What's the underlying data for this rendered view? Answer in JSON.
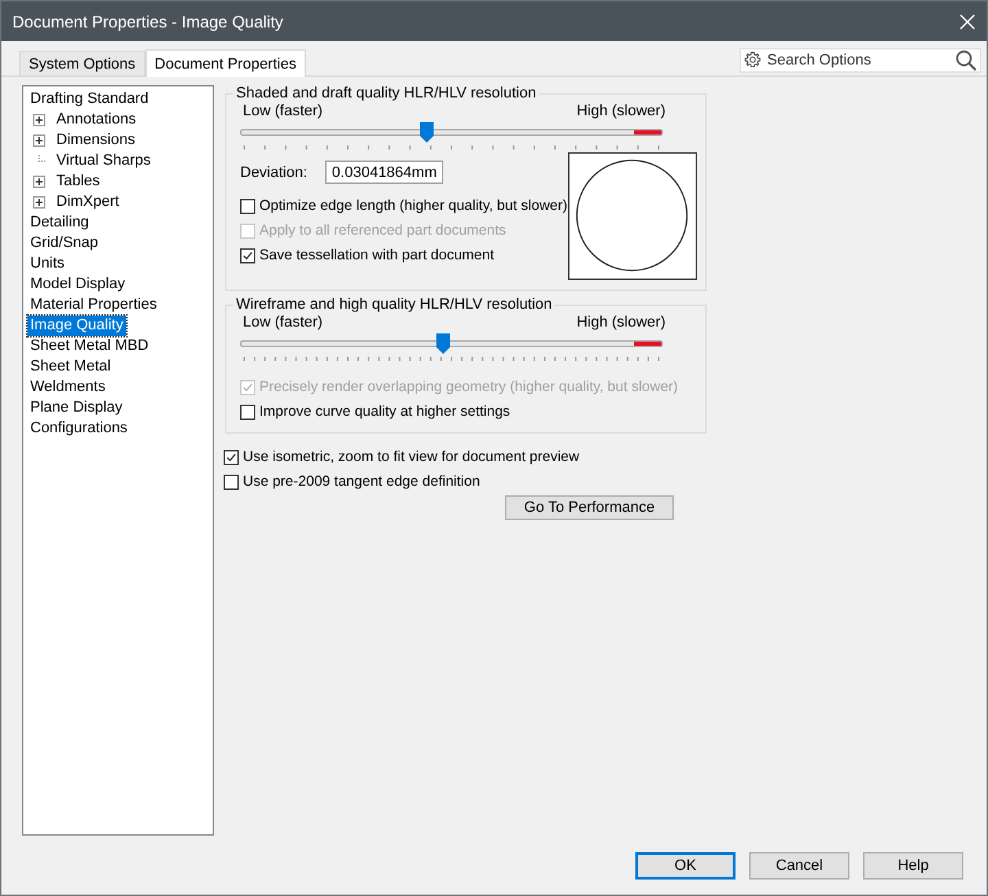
{
  "window": {
    "title": "Document Properties - Image Quality"
  },
  "tabs": [
    {
      "label": "System Options",
      "selected": false
    },
    {
      "label": "Document Properties",
      "selected": true
    }
  ],
  "search": {
    "placeholder": "Search Options"
  },
  "tree": [
    {
      "label": "Drafting Standard",
      "selected": false,
      "children": [
        {
          "label": "Annotations",
          "expandable": true,
          "selected": false
        },
        {
          "label": "Dimensions",
          "expandable": true,
          "selected": false
        },
        {
          "label": "Virtual Sharps",
          "expandable": false,
          "selected": false
        },
        {
          "label": "Tables",
          "expandable": true,
          "selected": false
        },
        {
          "label": "DimXpert",
          "expandable": true,
          "selected": false
        }
      ]
    },
    {
      "label": "Detailing",
      "selected": false
    },
    {
      "label": "Grid/Snap",
      "selected": false
    },
    {
      "label": "Units",
      "selected": false
    },
    {
      "label": "Model Display",
      "selected": false
    },
    {
      "label": "Material Properties",
      "selected": false
    },
    {
      "label": "Image Quality",
      "selected": true
    },
    {
      "label": "Sheet Metal MBD",
      "selected": false
    },
    {
      "label": "Sheet Metal",
      "selected": false
    },
    {
      "label": "Weldments",
      "selected": false
    },
    {
      "label": "Plane Display",
      "selected": false
    },
    {
      "label": "Configurations",
      "selected": false
    }
  ],
  "groups": [
    {
      "title": "Shaded and draft quality HLR/HLV resolution",
      "low_label": "Low (faster)",
      "high_label": "High (slower)",
      "level": 0.44,
      "deviation": {
        "label": "Deviation:",
        "value": "0.03041864mm"
      },
      "options": [
        {
          "label": "Optimize edge length (higher quality, but slower)",
          "checked": false,
          "disabled": false
        },
        {
          "label": "Apply to all referenced part documents",
          "checked": false,
          "disabled": true
        },
        {
          "label": "Save tessellation with part document",
          "checked": true,
          "disabled": false
        }
      ]
    },
    {
      "title": "Wireframe and high quality HLR/HLV resolution",
      "low_label": "Low (faster)",
      "high_label": "High (slower)",
      "level": 0.48,
      "options": [
        {
          "label": "Precisely render overlapping geometry (higher quality, but slower)",
          "checked": true,
          "disabled": true
        },
        {
          "label": "Improve curve quality at higher settings",
          "checked": false,
          "disabled": false
        }
      ]
    }
  ],
  "options": [
    {
      "label": "Use isometric, zoom to fit view for document preview",
      "checked": true,
      "disabled": false
    },
    {
      "label": "Use pre-2009 tangent edge definition",
      "checked": false,
      "disabled": false
    }
  ],
  "performance_button": "Go To Performance",
  "buttons": [
    {
      "label": "OK",
      "selected": true
    },
    {
      "label": "Cancel",
      "selected": false
    },
    {
      "label": "Help",
      "selected": false
    }
  ]
}
